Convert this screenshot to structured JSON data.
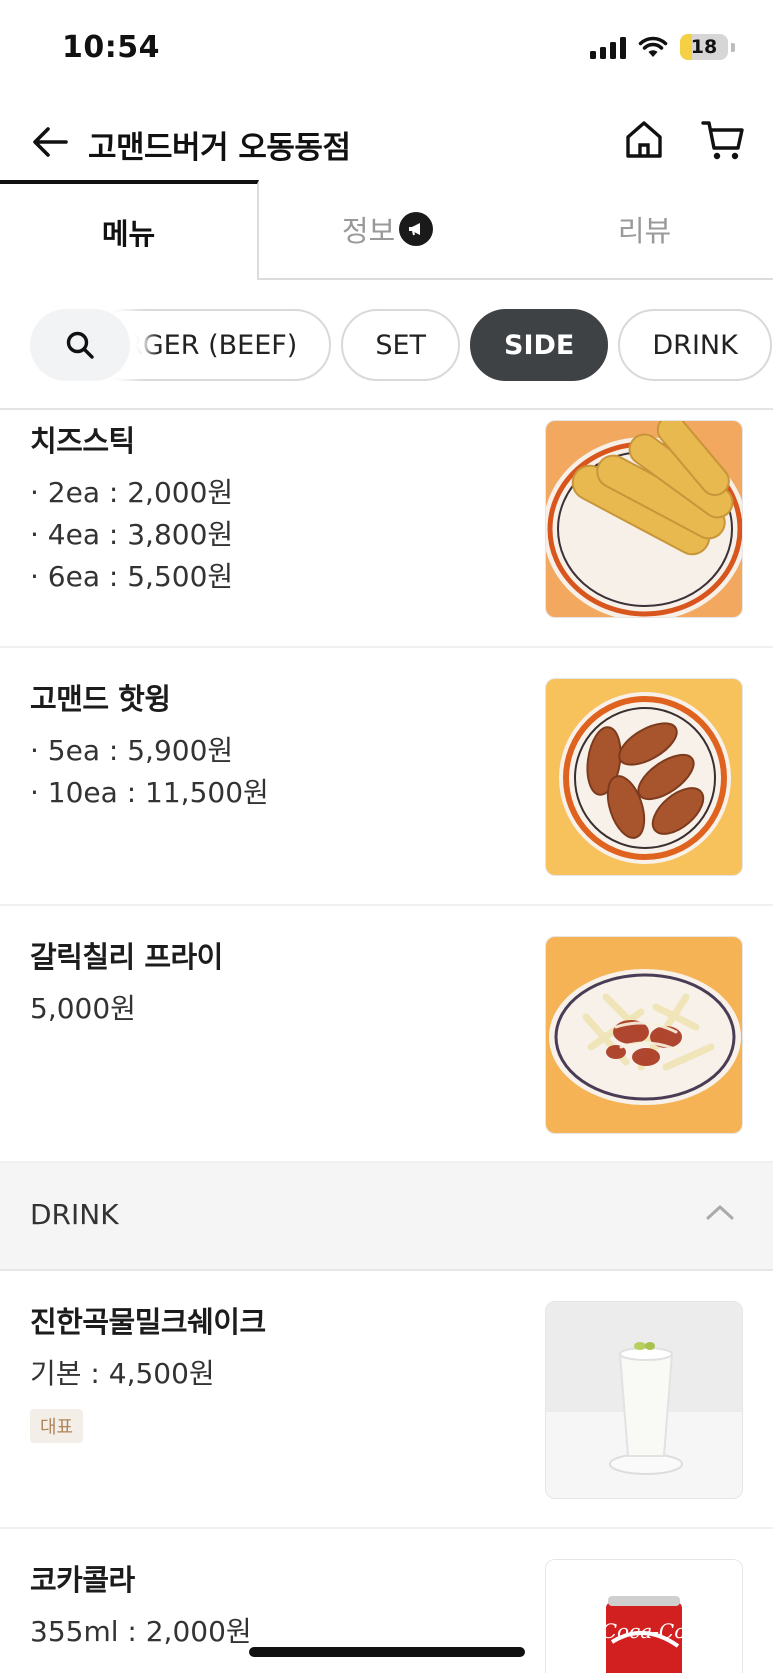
{
  "status_bar": {
    "time": "10:54",
    "battery": "18",
    "battery_level": 0.18
  },
  "header": {
    "title": "고맨드버거 오동동점"
  },
  "tabs": [
    {
      "label": "메뉴",
      "active": true
    },
    {
      "label": "정보",
      "active": false,
      "badge_icon": "megaphone-icon"
    },
    {
      "label": "리뷰",
      "active": false
    }
  ],
  "categories": [
    {
      "label": "RGER (BEEF)",
      "active": false
    },
    {
      "label": "SET",
      "active": false
    },
    {
      "label": "SIDE",
      "active": true
    },
    {
      "label": "DRINK",
      "active": false
    }
  ],
  "side_items": [
    {
      "name": "치즈스틱",
      "prices": [
        "· 2ea : 2,000원",
        "· 4ea : 3,800원",
        "· 6ea : 5,500원"
      ]
    },
    {
      "name": "고맨드 핫윙",
      "prices": [
        "· 5ea : 5,900원",
        "· 10ea : 11,500원"
      ]
    },
    {
      "name": "갈릭칠리 프라이",
      "prices": [
        "5,000원"
      ]
    }
  ],
  "drink_section": {
    "title": "DRINK"
  },
  "drink_items": [
    {
      "name": "진한곡물밀크쉐이크",
      "prices": [
        "기본 : 4,500원"
      ],
      "badge": "대표"
    },
    {
      "name": "코카콜라",
      "prices": [
        "355ml : 2,000원"
      ]
    }
  ],
  "colors": {
    "active_chip": "#3f4245",
    "accent_text": "#111111",
    "badge_text": "#b0855a",
    "badge_bg": "#f3efe8"
  }
}
